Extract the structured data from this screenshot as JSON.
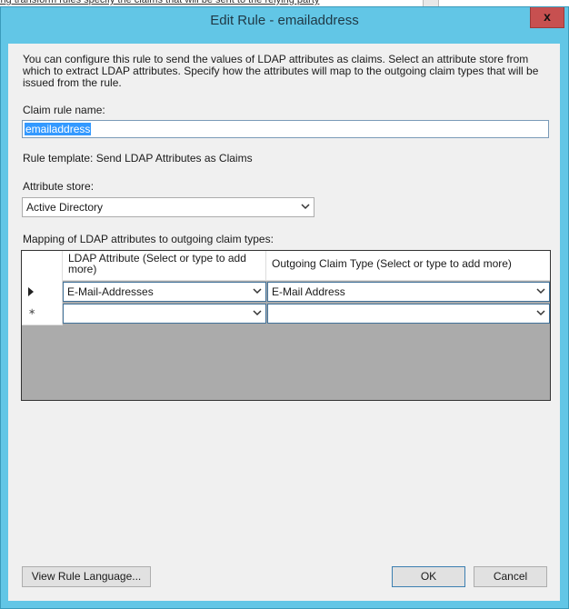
{
  "background": {
    "text": "ing transform rules specify the claims that will be sent to the relying party"
  },
  "window": {
    "title": "Edit Rule - emailaddress",
    "close_label": "x"
  },
  "form": {
    "description": "You can configure this rule to send the values of LDAP attributes as claims. Select an attribute store from which to extract LDAP attributes. Specify how the attributes will map to the outgoing claim types that will be issued from the rule.",
    "claim_rule_name_label": "Claim rule name:",
    "claim_rule_name_value": "emailaddress",
    "rule_template_text": "Rule template: Send LDAP Attributes as Claims",
    "attribute_store_label": "Attribute store:",
    "attribute_store_value": "Active Directory",
    "mapping_label": "Mapping of LDAP attributes to outgoing claim types:"
  },
  "mapping_grid": {
    "columns": [
      "LDAP Attribute (Select or type to add more)",
      "Outgoing Claim Type (Select or type to add more)"
    ],
    "rows": [
      {
        "indicator": "current-row",
        "ldap_attribute": "E-Mail-Addresses",
        "claim_type": "E-Mail Address"
      },
      {
        "indicator": "new-row",
        "ldap_attribute": "",
        "claim_type": ""
      }
    ]
  },
  "buttons": {
    "view_rule_language": "View Rule Language...",
    "ok": "OK",
    "cancel": "Cancel"
  }
}
